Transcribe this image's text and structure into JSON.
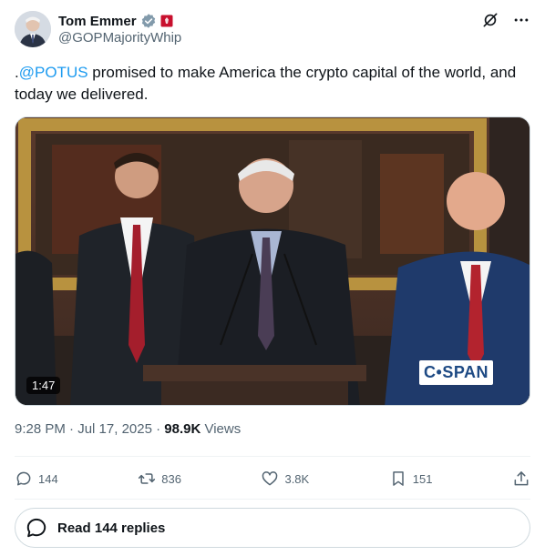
{
  "author": {
    "name": "Tom Emmer",
    "handle": "@GOPMajorityWhip"
  },
  "tweet": {
    "prefix": ".",
    "mention": "@POTUS",
    "text": " promised to make America the crypto capital of the world, and today we delivered."
  },
  "media": {
    "duration": "1:47",
    "watermark": "C•SPAN"
  },
  "meta": {
    "time": "9:28 PM",
    "sep1": " · ",
    "date": "Jul 17, 2025",
    "sep2": " · ",
    "views": "98.9K",
    "views_label": " Views"
  },
  "actions": {
    "replies": "144",
    "reposts": "836",
    "likes": "3.8K",
    "bookmarks": "151"
  },
  "read_replies": "Read 144 replies",
  "colors": {
    "link": "#1d9bf0",
    "text": "#0f1419",
    "secondary": "#536471"
  }
}
